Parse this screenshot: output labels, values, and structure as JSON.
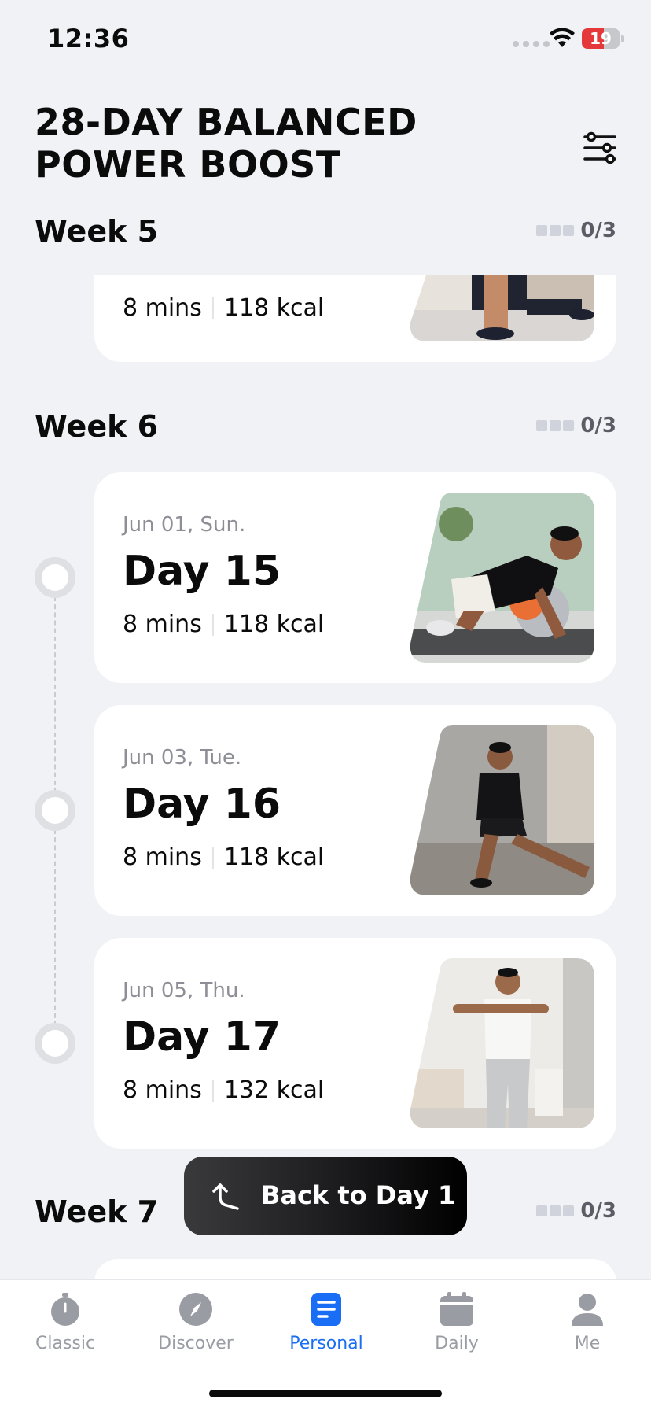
{
  "status_bar": {
    "time": "12:36",
    "battery": "19",
    "battery_level": 0.19
  },
  "header": {
    "title": "28-DAY BALANCED POWER BOOST"
  },
  "weeks": [
    {
      "title": "Week 5",
      "progress": "0/3"
    },
    {
      "title": "Week 6",
      "progress": "0/3"
    },
    {
      "title": "Week 7",
      "progress": "0/3"
    }
  ],
  "partial_card": {
    "duration": "8 mins",
    "calories": "118 kcal"
  },
  "days": [
    {
      "date": "Jun 01, Sun.",
      "title": "Day 15",
      "duration": "8 mins",
      "calories": "118 kcal"
    },
    {
      "date": "Jun 03, Tue.",
      "title": "Day 16",
      "duration": "8 mins",
      "calories": "118 kcal"
    },
    {
      "date": "Jun 05, Thu.",
      "title": "Day 17",
      "duration": "8 mins",
      "calories": "132 kcal"
    }
  ],
  "back_button": {
    "label": "Back to Day 1"
  },
  "tabs": [
    {
      "label": "Classic",
      "icon": "stopwatch-icon"
    },
    {
      "label": "Discover",
      "icon": "compass-icon"
    },
    {
      "label": "Personal",
      "icon": "document-icon",
      "active": true
    },
    {
      "label": "Daily",
      "icon": "calendar-icon"
    },
    {
      "label": "Me",
      "icon": "person-icon"
    }
  ],
  "colors": {
    "accent": "#1a6ef5",
    "background": "#f1f2f6",
    "battery_low": "#e5383b"
  }
}
